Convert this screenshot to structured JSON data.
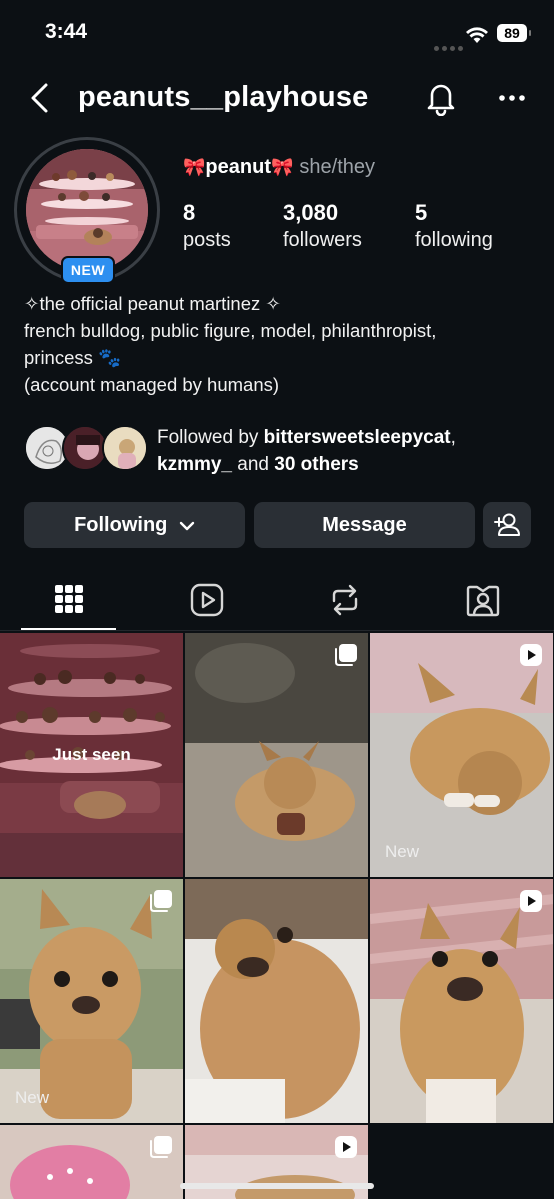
{
  "status_bar": {
    "time": "3:44",
    "battery": "89"
  },
  "header": {
    "username": "peanuts__playhouse"
  },
  "profile": {
    "badge": "NEW",
    "display_name": "peanut",
    "bow_emoji": "🎀",
    "pronouns": "she/they",
    "stats": [
      {
        "value": "8",
        "label": "posts"
      },
      {
        "value": "3,080",
        "label": "followers"
      },
      {
        "value": "5",
        "label": "following"
      }
    ],
    "bio": [
      "✧the official peanut martinez ✧",
      "french bulldog, public figure, model, philanthropist,",
      "princess 🐾",
      "(account managed by humans)"
    ],
    "followed_by": {
      "prefix": "Followed by ",
      "user1": "bittersweetsleepycat",
      "comma": ",",
      "user2": "kzmmy_",
      "middle": " and ",
      "others": "30 others"
    }
  },
  "actions": {
    "following": "Following",
    "message": "Message"
  },
  "tabs": [
    "grid-icon",
    "reels-icon",
    "reposts-icon",
    "tagged-icon"
  ],
  "grid": [
    {
      "label": "Just seen",
      "type": "label-center"
    },
    {
      "overlay": "multi",
      "label": ""
    },
    {
      "overlay": "reel",
      "label": "New"
    },
    {
      "overlay": "multi",
      "label": "New"
    },
    {
      "overlay": "none",
      "label": ""
    },
    {
      "overlay": "reel",
      "label": ""
    },
    {
      "overlay": "multi",
      "label": ""
    },
    {
      "overlay": "reel",
      "label": ""
    }
  ],
  "colors": {
    "background": "#0c1014",
    "button": "#2a2f35",
    "badge": "#2d8ff0"
  }
}
